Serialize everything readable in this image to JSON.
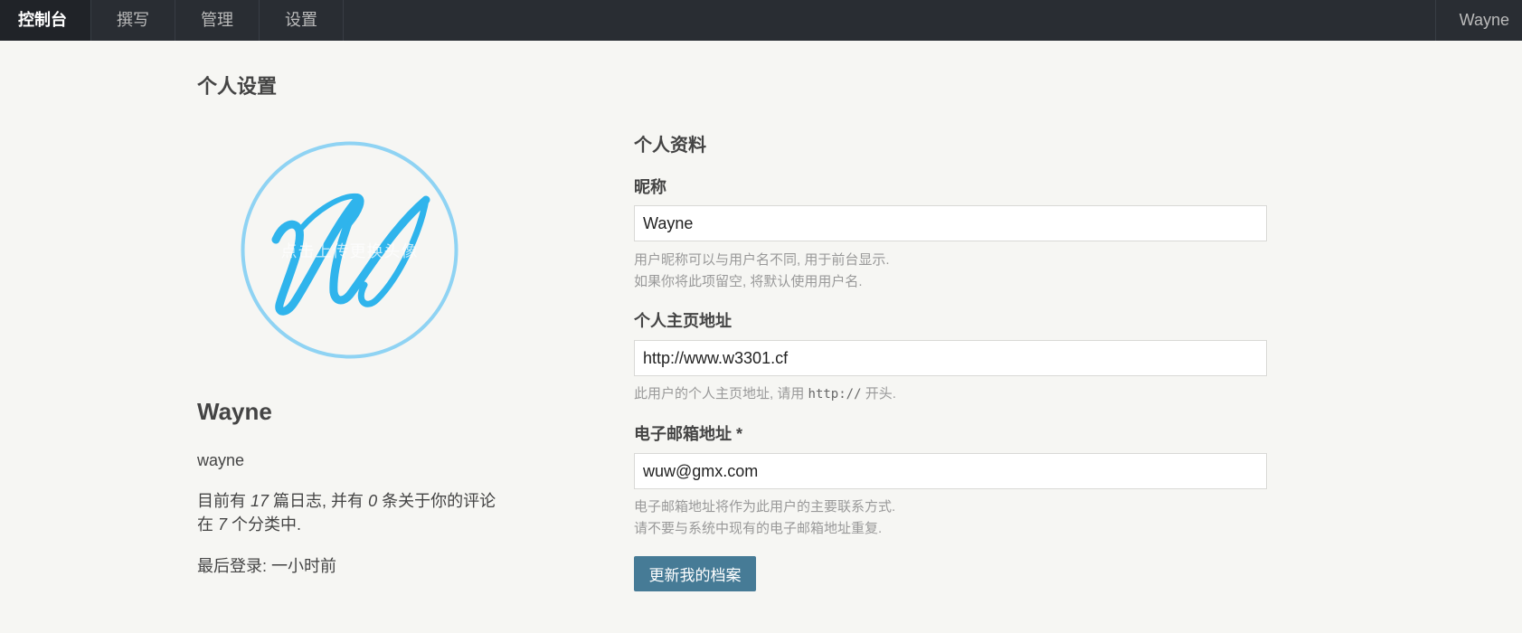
{
  "nav": {
    "items": [
      {
        "label": "控制台",
        "active": true
      },
      {
        "label": "撰写",
        "active": false
      },
      {
        "label": "管理",
        "active": false
      },
      {
        "label": "设置",
        "active": false
      }
    ],
    "user": "Wayne"
  },
  "page": {
    "title": "个人设置"
  },
  "profile": {
    "avatar_hint": "点击上传更换头像",
    "avatar_icon": "script-w-logo-icon",
    "display_name": "Wayne",
    "username": "wayne",
    "stats": {
      "prefix": "目前有 ",
      "posts": "17",
      "mid1": " 篇日志, 并有 ",
      "comments": "0",
      "mid2": " 条关于你的评论在 ",
      "categories": "7",
      "suffix": " 个分类中."
    },
    "last_login": "最后登录: 一小时前"
  },
  "form": {
    "section_title": "个人资料",
    "nickname": {
      "label": "昵称",
      "value": "Wayne",
      "desc1": "用户昵称可以与用户名不同, 用于前台显示.",
      "desc2": "如果你将此项留空, 将默认使用用户名."
    },
    "homepage": {
      "label": "个人主页地址",
      "value": "http://www.w3301.cf",
      "desc_prefix": "此用户的个人主页地址, 请用 ",
      "desc_code": "http://",
      "desc_suffix": " 开头."
    },
    "email": {
      "label": "电子邮箱地址 *",
      "value": "wuw@gmx.com",
      "desc1": "电子邮箱地址将作为此用户的主要联系方式.",
      "desc2": "请不要与系统中现有的电子邮箱地址重复."
    },
    "submit_label": "更新我的档案"
  },
  "colors": {
    "topbar": "#292d33",
    "background": "#f6f6f3",
    "accent": "#467b96",
    "avatar_ring": "#8fd3f3",
    "avatar_letter": "#2fb4ec"
  }
}
